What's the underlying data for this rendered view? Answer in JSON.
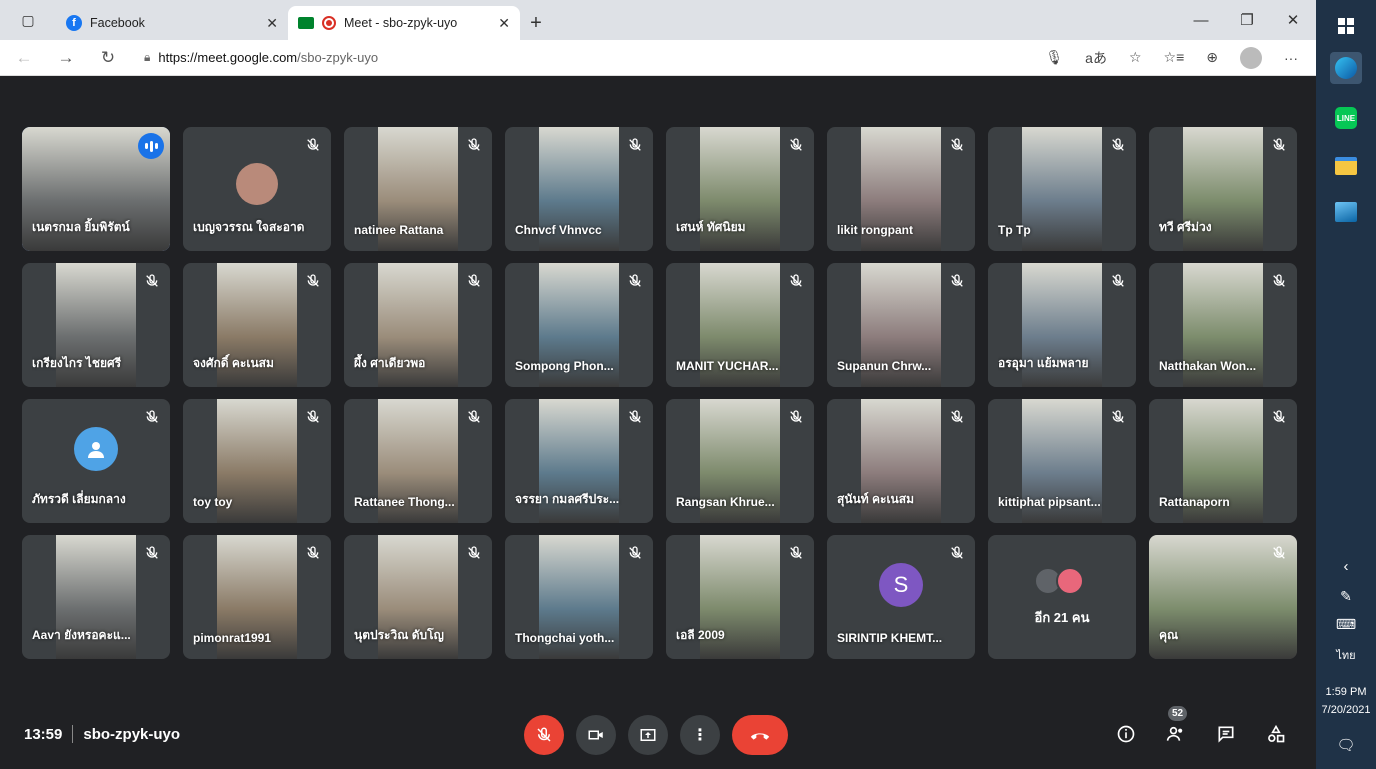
{
  "browser": {
    "tabs": [
      {
        "title": "Facebook",
        "active": false
      },
      {
        "title": "Meet - sbo-zpyk-uyo",
        "active": true
      }
    ],
    "url_host": "https://meet.google.com",
    "url_path": "/sbo-zpyk-uyo"
  },
  "meeting": {
    "time": "13:59",
    "code": "sbo-zpyk-uyo",
    "participant_count": "52",
    "more_label": "อีก 21 คน"
  },
  "participants": [
    {
      "name": "เนตรกมล ยิ้มพิรัตน์",
      "speaking": true,
      "avatar": null
    },
    {
      "name": "เบญจวรรณ ใจสะอาด",
      "speaking": false,
      "avatar": "photo"
    },
    {
      "name": "natinee Rattana"
    },
    {
      "name": "Chnvcf Vhnvcc"
    },
    {
      "name": "เสนห์ ทัศนิยม"
    },
    {
      "name": "likit rongpant"
    },
    {
      "name": "Tp Tp"
    },
    {
      "name": "ทวี ศรีม่วง"
    },
    {
      "name": "เกรียงไกร ไชยศรี"
    },
    {
      "name": "จงศักดิ์ คะเนสม"
    },
    {
      "name": "ผึ้ง ศาเดียวพอ"
    },
    {
      "name": "Sompong Phon..."
    },
    {
      "name": "MANIT YUCHAR..."
    },
    {
      "name": "Supanun Chrw..."
    },
    {
      "name": "อรอุมา แย้มพลาย"
    },
    {
      "name": "Natthakan Won..."
    },
    {
      "name": "ภัทรวดี เลี่ยมกลาง",
      "avatar": "person"
    },
    {
      "name": "toy toy"
    },
    {
      "name": "Rattanee Thong..."
    },
    {
      "name": "จรรยา กมลศรีประ..."
    },
    {
      "name": "Rangsan Khrue..."
    },
    {
      "name": "สุนันท์ คะเนสม"
    },
    {
      "name": "kittiphat pipsant..."
    },
    {
      "name": "Rattanaporn"
    },
    {
      "name": "Aavา ยังหรอคะแ..."
    },
    {
      "name": "pimonrat1991"
    },
    {
      "name": "นุตประวิณ ดับโญ"
    },
    {
      "name": "Thongchai yoth..."
    },
    {
      "name": "เอลี 2009"
    },
    {
      "name": "SIRINTIP KHEMT...",
      "avatar": "S"
    },
    {
      "name": "คุณ"
    }
  ],
  "taskbar": {
    "time": "1:59 PM",
    "date": "7/20/2021",
    "lang": "ไทย"
  },
  "colors": {
    "meet_bg": "#202124",
    "tile_bg": "#3c4043",
    "red": "#ea4335",
    "speaking": "#8ab4f8",
    "avatar_purple": "#7e57c2",
    "avatar_blue": "#4fa3e6"
  }
}
